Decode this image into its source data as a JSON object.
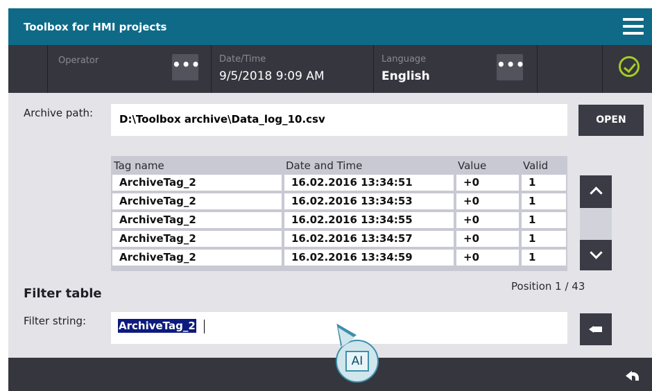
{
  "app": {
    "title": "Toolbox for HMI projects",
    "accent_color": "#0f6a88",
    "ok_color": "#a4cc25"
  },
  "status": {
    "operator_label": "Operator",
    "operator_button": "•••",
    "datetime_label": "Date/Time",
    "datetime_value": "9/5/2018 9:09 AM",
    "language_label": "Language",
    "language_value": "English",
    "language_button": "•••",
    "status_icon": "check-circle-icon"
  },
  "archive": {
    "label": "Archive path:",
    "path": "D:\\Toolbox archive\\Data_log_10.csv",
    "open_button": "OPEN"
  },
  "table": {
    "columns": [
      "Tag name",
      "Date and Time",
      "Value",
      "Valid"
    ],
    "rows": [
      [
        "ArchiveTag_2",
        "16.02.2016 13:34:51",
        "+0",
        "1"
      ],
      [
        "ArchiveTag_2",
        "16.02.2016 13:34:53",
        "+0",
        "1"
      ],
      [
        "ArchiveTag_2",
        "16.02.2016 13:34:55",
        "+0",
        "1"
      ],
      [
        "ArchiveTag_2",
        "16.02.2016 13:34:57",
        "+0",
        "1"
      ],
      [
        "ArchiveTag_2",
        "16.02.2016 13:34:59",
        "+0",
        "1"
      ]
    ],
    "position": "Position 1 / 43"
  },
  "filter": {
    "heading": "Filter table",
    "label": "Filter string:",
    "value": "ArchiveTag_2"
  },
  "keyboard": {
    "key_label": "AI"
  },
  "nav": {
    "back_icon": "back-arrow-icon"
  }
}
